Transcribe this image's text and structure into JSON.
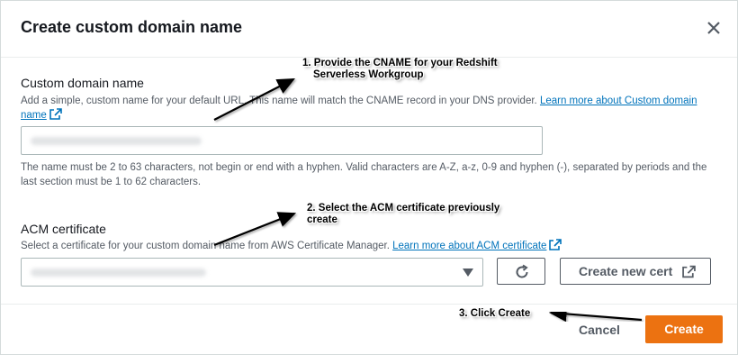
{
  "modal": {
    "title": "Create custom domain name",
    "close_icon": "close-icon"
  },
  "domain": {
    "label": "Custom domain name",
    "description": "Add a simple, custom name for your default URL. This name will match the CNAME record in your DNS provider.",
    "learn_more": "Learn more about Custom domain name",
    "value": "(blurred)",
    "constraint": "The name must be 2 to 63 characters, not begin or end with a hyphen. Valid characters are A-Z, a-z, 0-9 and hyphen (-), separated by periods and the last section must be 1 to 62 characters."
  },
  "acm": {
    "label": "ACM certificate",
    "description": "Select a certificate for your custom domain name from AWS Certificate Manager.",
    "learn_more": "Learn more about ACM certificate",
    "selected": "(blurred)",
    "refresh_icon": "refresh-icon",
    "new_cert_label": "Create new cert"
  },
  "footer": {
    "cancel_label": "Cancel",
    "create_label": "Create"
  },
  "annotations": {
    "step1": "1. Provide the CNAME for your Redshift",
    "step1b": "Serverless Workgroup",
    "step2": "2. Select the ACM certificate previously",
    "step2b": "create",
    "step3": "3. Click Create"
  },
  "colors": {
    "primary": "#ec7211",
    "link": "#0073bb",
    "text": "#16191f",
    "muted": "#545b64"
  }
}
